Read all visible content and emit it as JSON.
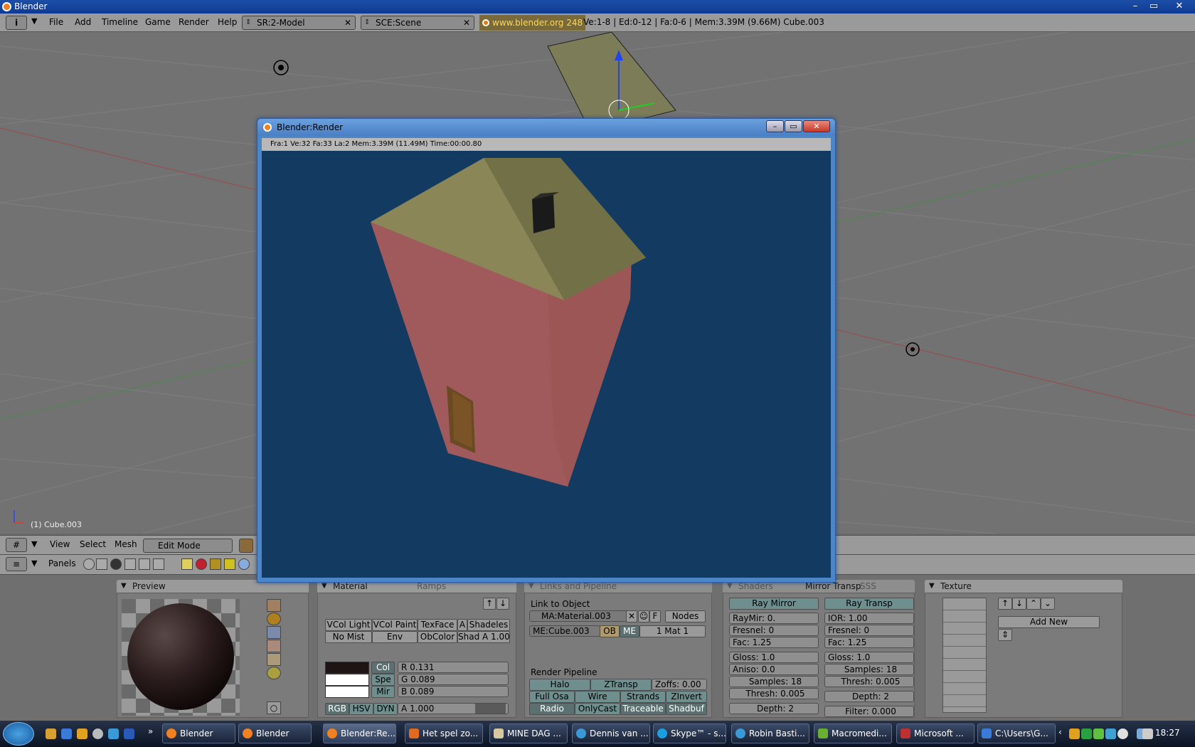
{
  "window": {
    "title": "Blender",
    "min": "–",
    "max": "▭",
    "close": "✕"
  },
  "topbar": {
    "menus": [
      "File",
      "Add",
      "Timeline",
      "Game",
      "Render",
      "Help"
    ],
    "screen": "SR:2-Model",
    "scene": "SCE:Scene",
    "url": "www.blender.org 248",
    "stats": "Ve:1-8 | Ed:0-12 | Fa:0-6 | Mem:3.39M (9.66M) Cube.003"
  },
  "viewport": {
    "object_info": "(1) Cube.003"
  },
  "view_header": {
    "menus": [
      "View",
      "Select",
      "Mesh"
    ],
    "mode": "Edit Mode"
  },
  "panel_header": {
    "label": "Panels"
  },
  "render_window": {
    "title": "Blender:Render",
    "info": "Fra:1  Ve:32 Fa:33 La:2 Mem:3.39M (11.49M) Time:00:00.80"
  },
  "preview_panel": {
    "title": "Preview"
  },
  "material_panel": {
    "tab": "Material",
    "tab2": "Ramps",
    "row1": [
      "VCol Light",
      "VCol Paint",
      "TexFace",
      "A",
      "Shadeles"
    ],
    "row2": [
      "No Mist",
      "Env",
      "ObColor",
      "Shad A 1.00"
    ],
    "color_buttons": [
      "Col",
      "Spe",
      "Mir"
    ],
    "rgb": [
      "R 0.131",
      "G 0.089",
      "B 0.089"
    ],
    "modes": [
      "RGB",
      "HSV",
      "DYN"
    ],
    "alpha": "A 1.000",
    "colors": {
      "col": "#1e1414",
      "spe": "#ffffff",
      "mir": "#ffffff"
    }
  },
  "links_panel": {
    "tab": "Links and Pipeline",
    "link_label": "Link to Object",
    "material": "MA:Material.003",
    "f_btn": "F",
    "nodes": "Nodes",
    "mesh": "ME:Cube.003",
    "ob": "OB",
    "me": "ME",
    "mat": "1 Mat 1",
    "pipeline_label": "Render Pipeline",
    "row1": [
      "Halo",
      "ZTransp",
      "Zoffs: 0.00"
    ],
    "row2": [
      "Full Osa",
      "Wire",
      "Strands",
      "ZInvert"
    ],
    "row3": [
      "Radio",
      "OnlyCast",
      "Traceable",
      "Shadbuf"
    ]
  },
  "mirror_panel": {
    "tab": "Shaders",
    "tab2": "Mirror Transp",
    "tab3": "SSS",
    "ray_mirror": "Ray Mirror",
    "ray_transp": "Ray Transp",
    "left": [
      "RayMir: 0.",
      "Fresnel: 0",
      "Fac: 1.25",
      "Gloss: 1.0",
      "Aniso: 0.0",
      "Samples: 18",
      "Thresh: 0.005",
      "Depth: 2"
    ],
    "right": [
      "IOR: 1.00",
      "Fresnel: 0",
      "Fac: 1.25",
      "Gloss: 1.0",
      "Samples: 18",
      "Thresh: 0.005",
      "Depth: 2",
      "Filter: 0.000"
    ]
  },
  "texture_panel": {
    "title": "Texture",
    "add_new": "Add New"
  },
  "taskbar": {
    "items": [
      "Blender",
      "Blender",
      "Blender:Re...",
      "Het spel zo...",
      "MINE DAG ...",
      "Dennis van ...",
      "Skype™ - s...",
      "Robin Basti...",
      "Macromedi...",
      "Microsoft ...",
      "C:\\Users\\G..."
    ],
    "clock": "18:27"
  }
}
